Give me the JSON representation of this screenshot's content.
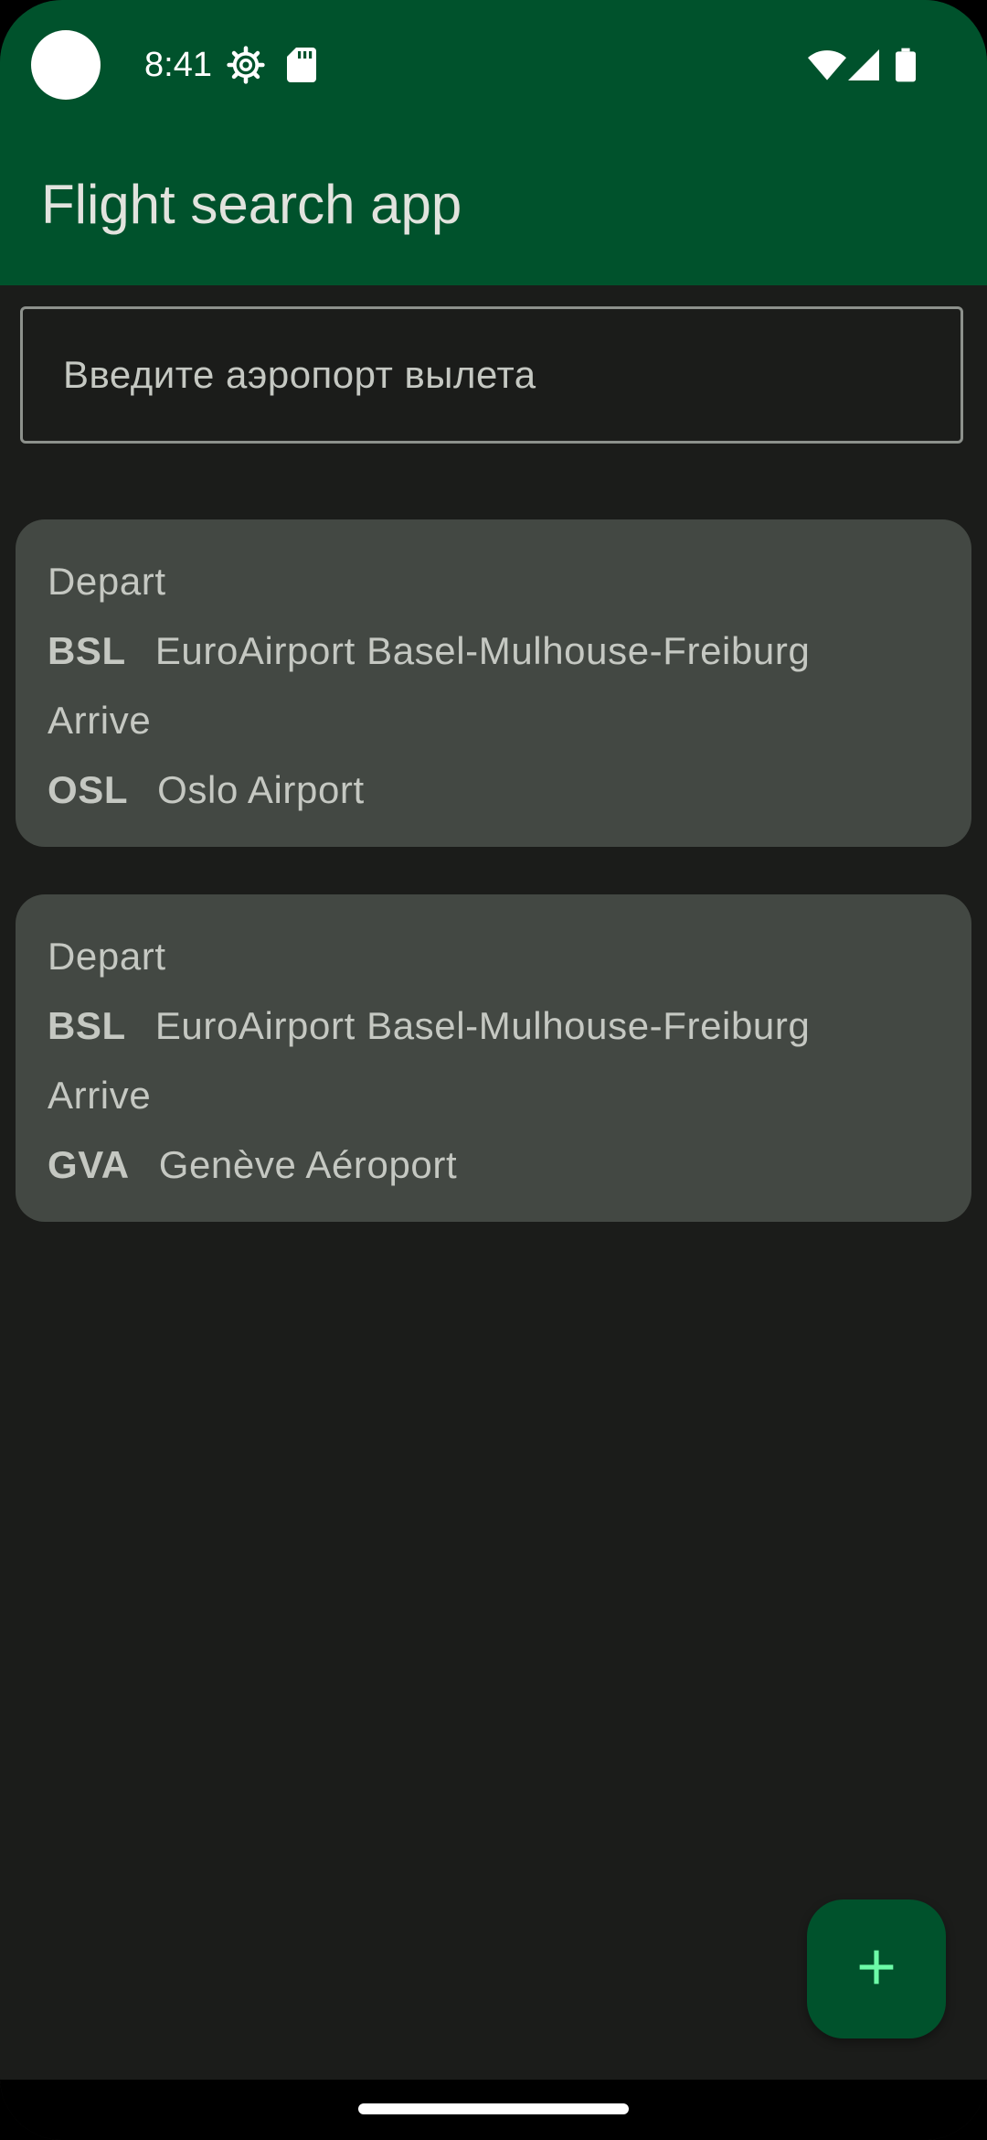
{
  "status_bar": {
    "time": "8:41",
    "icons": [
      "settings-icon",
      "sd-card-icon",
      "wifi-icon",
      "signal-icon",
      "battery-icon"
    ]
  },
  "app_bar": {
    "title": "Flight search app"
  },
  "search": {
    "placeholder": "Введите аэропорт вылета",
    "value": ""
  },
  "flights": [
    {
      "depart_label": "Depart",
      "depart_code": "BSL",
      "depart_name": "EuroAirport Basel-Mulhouse-Freiburg",
      "arrive_label": "Arrive",
      "arrive_code": "OSL",
      "arrive_name": "Oslo Airport"
    },
    {
      "depart_label": "Depart",
      "depart_code": "BSL",
      "depart_name": "EuroAirport Basel-Mulhouse-Freiburg",
      "arrive_label": "Arrive",
      "arrive_code": "GVA",
      "arrive_name": "Genève Aéroport"
    }
  ],
  "fab": {
    "icon": "plus-icon"
  },
  "colors": {
    "primary": "#00522c",
    "background": "#1b1c1a",
    "card": "#434843",
    "on_surface": "#c5c8c2",
    "fab_icon": "#6dfaa8"
  }
}
